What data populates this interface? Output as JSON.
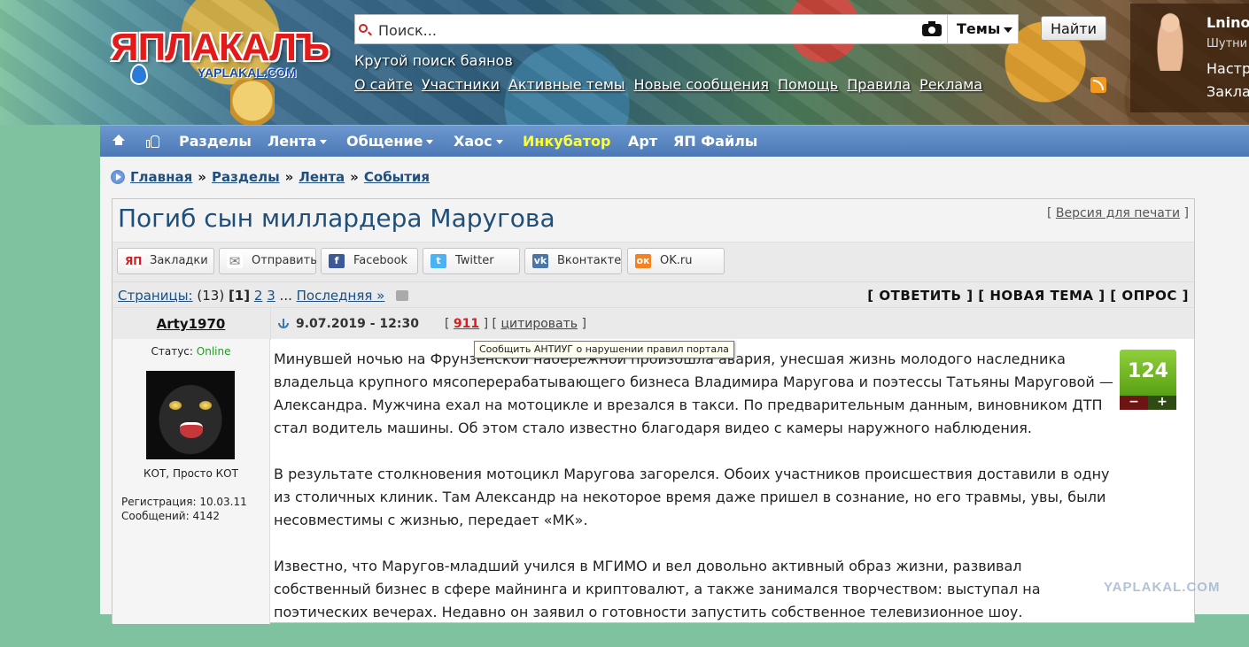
{
  "header": {
    "logo_text": "ЯПЛАКАЛЪ",
    "logo_sub": "YAPLAKAL.COM",
    "search_placeholder": "Поиск...",
    "theme_select": "Темы",
    "find_button": "Найти",
    "tagline": "Крутой поиск баянов",
    "links": [
      "О сайте",
      "Участники",
      "Активные темы",
      "Новые сообщения",
      "Помощь",
      "Правила",
      "Реклама"
    ],
    "user": {
      "name": "Lnino",
      "rank": "Шутни",
      "settings": "Настр",
      "bookmarks": "Закла"
    }
  },
  "nav": {
    "items": [
      {
        "label": "Разделы",
        "dropdown": false
      },
      {
        "label": "Лента",
        "dropdown": true
      },
      {
        "label": "Общение",
        "dropdown": true
      },
      {
        "label": "Хаос",
        "dropdown": true
      },
      {
        "label": "Инкубатор",
        "dropdown": false,
        "color": "#ffff30"
      },
      {
        "label": "Арт",
        "dropdown": false
      },
      {
        "label": "ЯП Файлы",
        "dropdown": false
      }
    ]
  },
  "breadcrumb": {
    "items": [
      "Главная",
      "Разделы",
      "Лента",
      "События"
    ],
    "separator": "»"
  },
  "topic": {
    "title": "Погиб сын миллардера Маругова",
    "print_version": "Версия для печати",
    "share": [
      {
        "label": "Закладки",
        "icon": "yap-icon",
        "color": "#d21f1f",
        "glyph": "ЯП"
      },
      {
        "label": "Отправить",
        "icon": "mail-icon",
        "color": "#8a8a8a",
        "glyph": "✉"
      },
      {
        "label": "Facebook",
        "icon": "facebook-icon",
        "color": "#3b5998",
        "glyph": "f"
      },
      {
        "label": "Twitter",
        "icon": "twitter-icon",
        "color": "#4ab3f4",
        "glyph": "t"
      },
      {
        "label": "Вконтакте",
        "icon": "vk-icon",
        "color": "#4a76a8",
        "glyph": "vk"
      },
      {
        "label": "OK.ru",
        "icon": "ok-icon",
        "color": "#f58220",
        "glyph": "ок"
      }
    ],
    "pages": {
      "label": "Страницы:",
      "count": "(13)",
      "current": "[1]",
      "links": [
        "2",
        "3"
      ],
      "ellipsis": "...",
      "last": "Последняя »"
    },
    "actions": "[ ОТВЕТИТЬ ] [ НОВАЯ ТЕМА ] [ ОПРОС ]"
  },
  "post": {
    "author": "Arty1970",
    "date": "9.07.2019 - 12:30",
    "number": "911",
    "quote": "цитировать",
    "tooltip": "Сообщить АНТИУГ о нарушении правил портала",
    "status_label": "Статус:",
    "status_value": "Online",
    "user_caption": "КОТ, Просто КОТ",
    "registration": "Регистрация: 10.03.11",
    "messages": "Сообщений: 4142",
    "rating": "124",
    "rate_minus": "−",
    "rate_plus": "+",
    "paragraphs": [
      "Минувшей ночью на Фрунзенской набережной произошла авария, унесшая жизнь молодого наследника владельца крупного мясоперерабатывающего бизнеса Владимира Маругова и поэтессы Татьяны Маруговой — Александра. Мужчина ехал на мотоцикле и врезался в такси. По предварительным данным, виновником ДТП стал водитель машины. Об этом стало известно благодаря видео с камеры наружного наблюдения.",
      "В результате столкновения мотоцикл Маругова загорелся. Обоих участников происшествия доставили в одну из столичных клиник. Там Александр на некоторое время даже пришел в сознание, но его травмы, увы, были несовместимы с жизнью, передает «МК».",
      "Известно, что Маругов-младший учился в МГИМО и вел довольно активный образ жизни, развивал собственный бизнес в сфере майнинга и криптовалют, а также занимался творчеством: выступал на поэтических вечерах. Недавно он заявил о готовности запустить собственное телевизионное шоу."
    ]
  },
  "watermark": "YAPLAKAL.COM"
}
